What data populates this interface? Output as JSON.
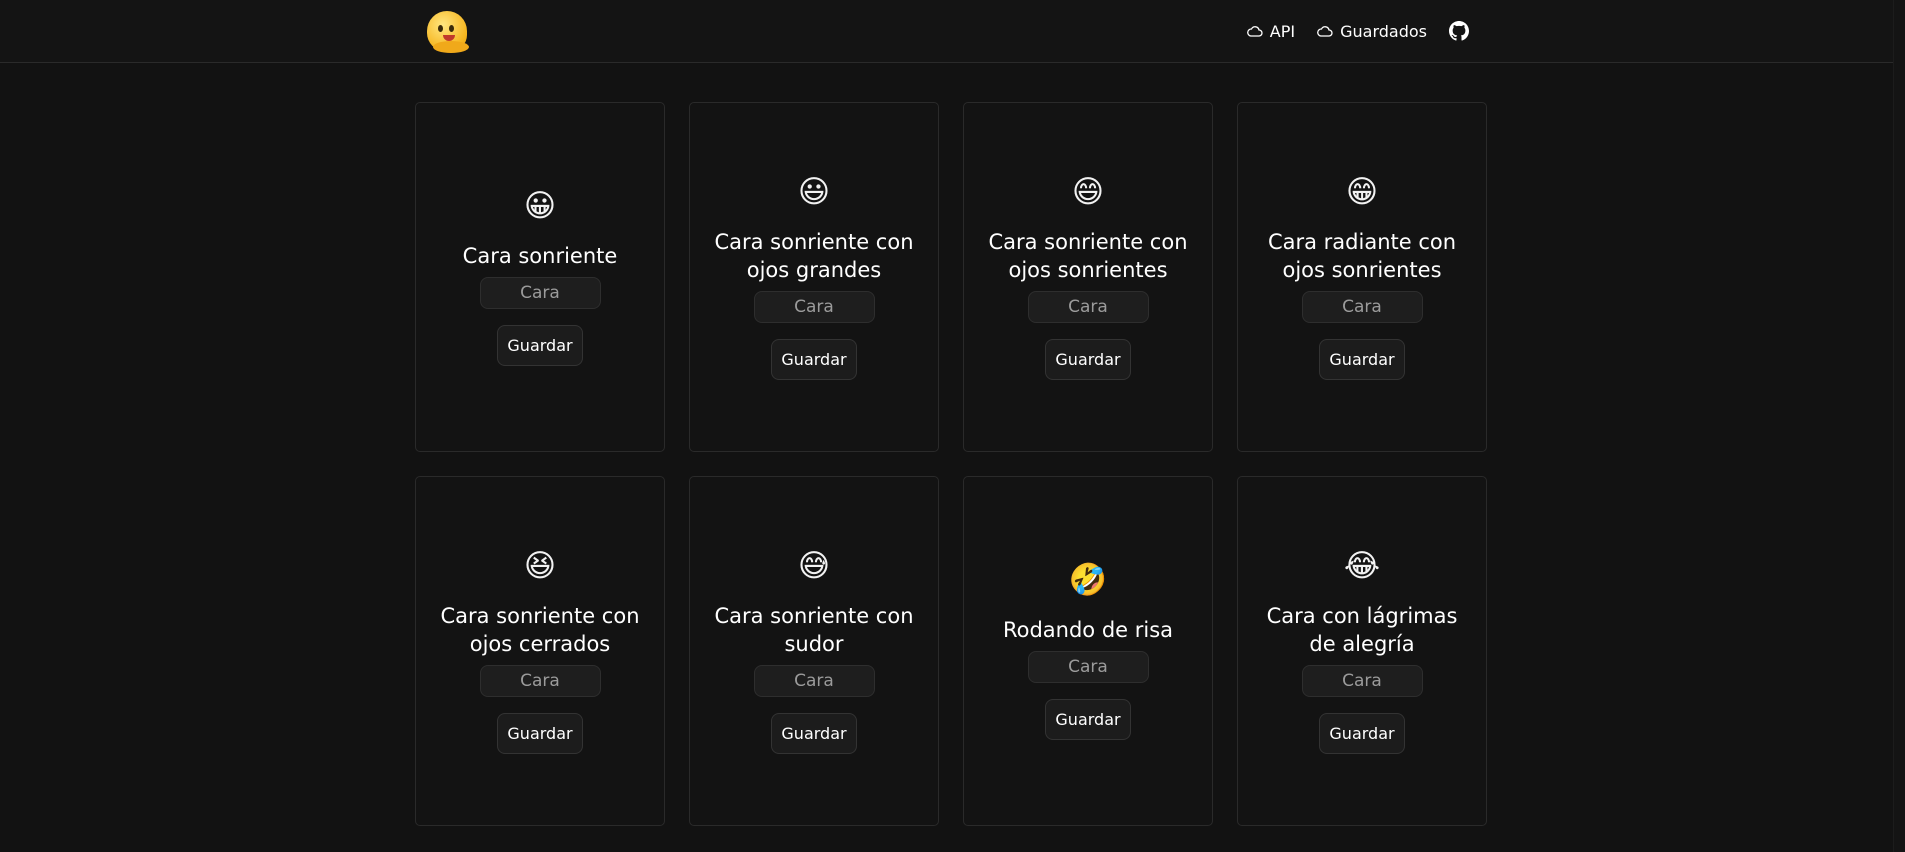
{
  "header": {
    "logo": {
      "icon": "melting-face-icon"
    },
    "nav": [
      {
        "label": "API",
        "icon": "cloud-icon"
      },
      {
        "label": "Guardados",
        "icon": "cloud-icon"
      }
    ],
    "github": {
      "icon": "github-icon"
    }
  },
  "cards": [
    {
      "emoji": "😀",
      "title": "Cara sonriente",
      "category": "Cara",
      "button": "Guardar"
    },
    {
      "emoji": "😃",
      "title": "Cara sonriente con ojos grandes",
      "category": "Cara",
      "button": "Guardar"
    },
    {
      "emoji": "😄",
      "title": "Cara sonriente con ojos sonrientes",
      "category": "Cara",
      "button": "Guardar"
    },
    {
      "emoji": "😁",
      "title": "Cara radiante con ojos sonrientes",
      "category": "Cara",
      "button": "Guardar"
    },
    {
      "emoji": "😆",
      "title": "Cara sonriente con ojos cerrados",
      "category": "Cara",
      "button": "Guardar"
    },
    {
      "emoji": "😅",
      "title": "Cara sonriente con sudor",
      "category": "Cara",
      "button": "Guardar"
    },
    {
      "emoji": "🤣",
      "title": "Rodando de risa",
      "category": "Cara",
      "button": "Guardar"
    },
    {
      "emoji": "😂",
      "title": "Cara con lágrimas de alegría",
      "category": "Cara",
      "button": "Guardar"
    }
  ]
}
